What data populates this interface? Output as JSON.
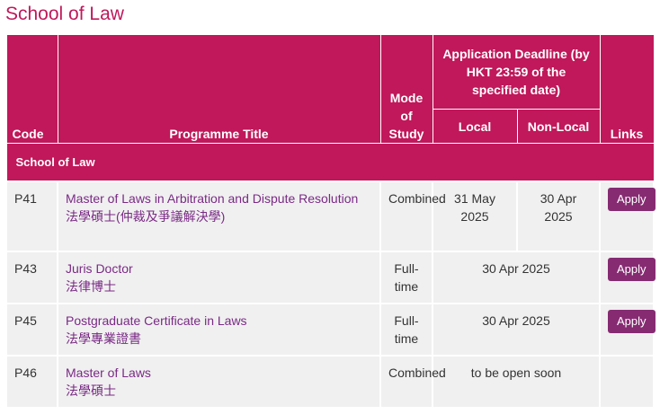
{
  "page": {
    "title": "School of Law"
  },
  "table": {
    "headers": {
      "code": "Code",
      "programme_title": "Programme Title",
      "mode_of_study": "Mode of Study",
      "application_deadline": "Application Deadline (by HKT 23:59 of the specified date)",
      "local": "Local",
      "non_local": "Non-Local",
      "links": "Links"
    },
    "group_label": "School of Law",
    "apply_label": "Apply",
    "rows": [
      {
        "code": "P41",
        "title_en": "Master of Laws in Arbitration and Dispute Resolution",
        "title_zh": "法學碩士(仲裁及爭議解決學)",
        "mode": "Combined",
        "local": "31 May 2025",
        "non_local": "30 Apr 2025",
        "has_apply": true
      },
      {
        "code": "P43",
        "title_en": "Juris Doctor",
        "title_zh": "法律博士",
        "mode": "Full-time",
        "deadline": "30 Apr 2025",
        "has_apply": true
      },
      {
        "code": "P45",
        "title_en": "Postgraduate Certificate in Laws",
        "title_zh": "法學專業證書",
        "mode": "Full-time",
        "deadline": "30 Apr 2025",
        "has_apply": true
      },
      {
        "code": "P46",
        "title_en": "Master of Laws",
        "title_zh": "法學碩士",
        "mode": "Combined",
        "deadline": "to be open soon",
        "has_apply": false
      }
    ]
  },
  "colors": {
    "accent": "#c0185a",
    "button": "#862b72",
    "link": "#7a2a85",
    "row_bg": "#f0f0f0"
  }
}
